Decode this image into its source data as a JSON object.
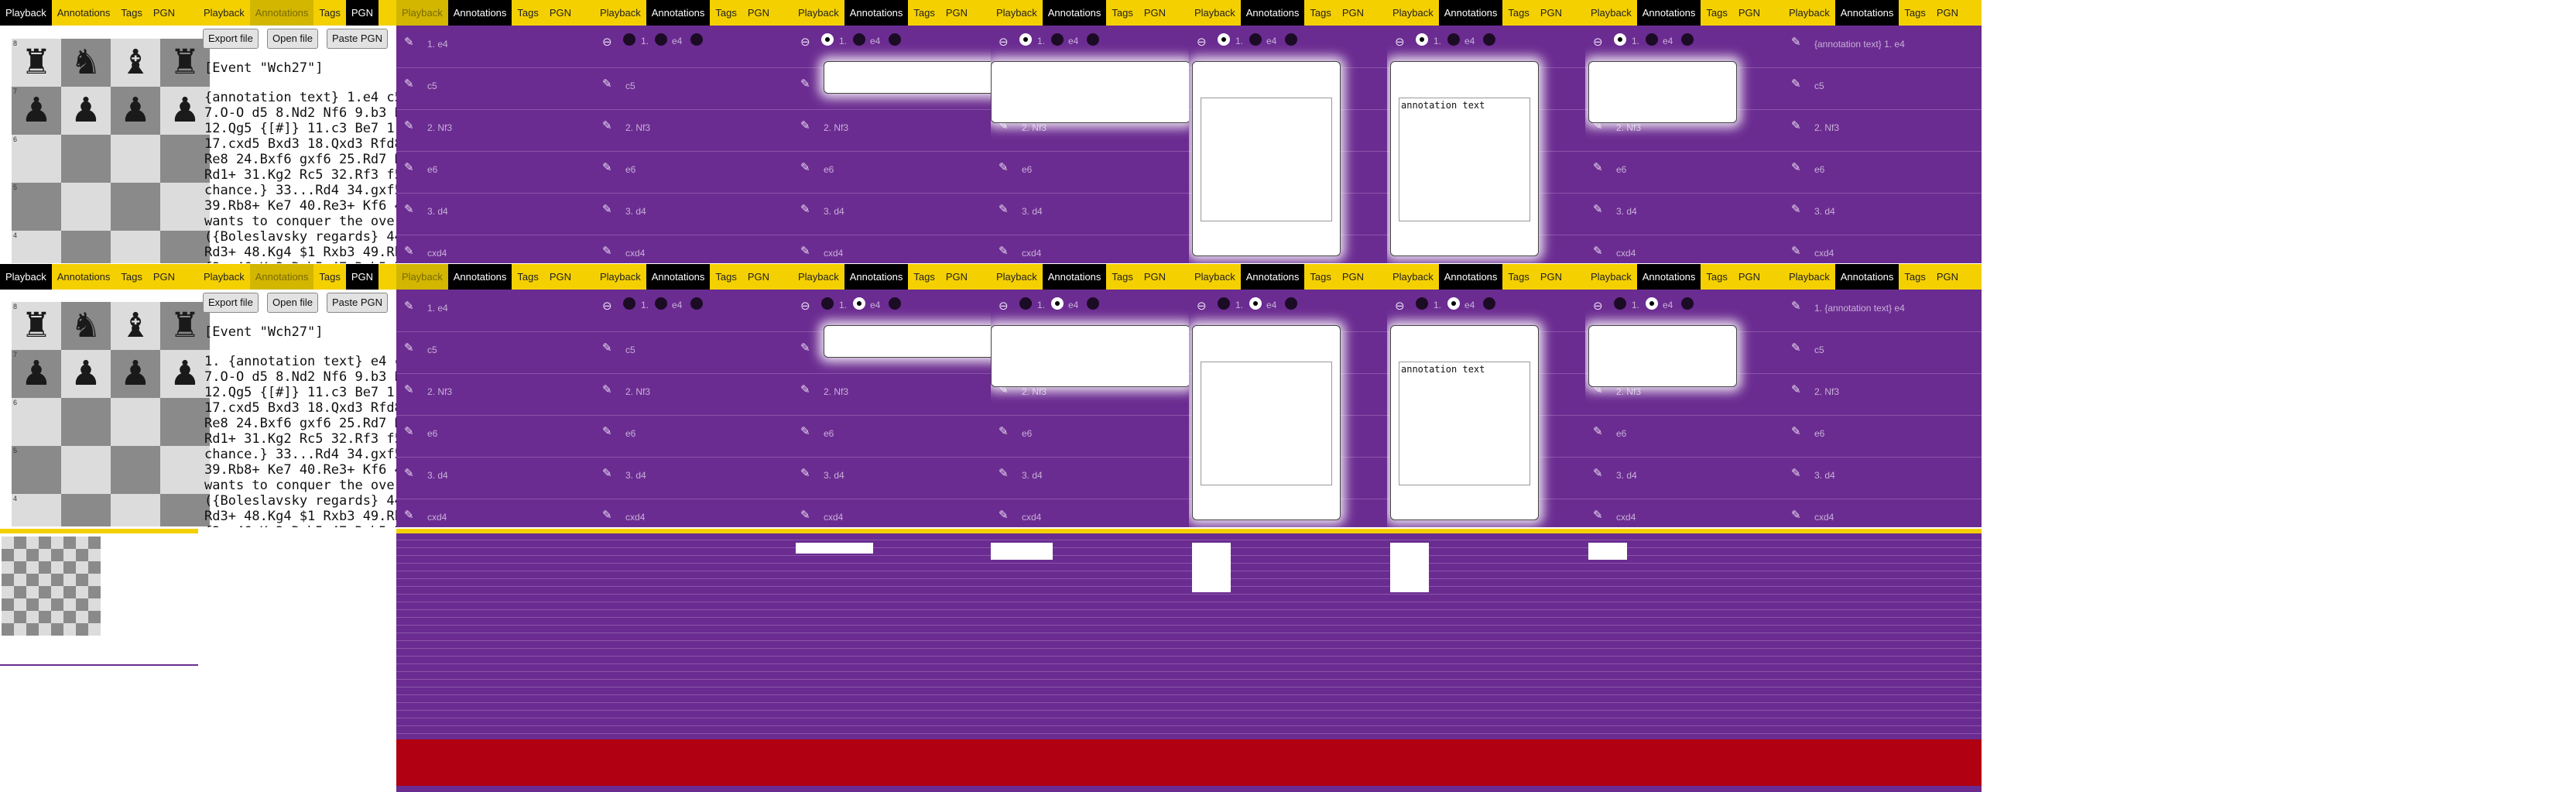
{
  "tabs": {
    "playback": "Playback",
    "annotations": "Annotations",
    "tags": "Tags",
    "pgn": "PGN"
  },
  "buttons": {
    "export": "Export file",
    "open": "Open file",
    "paste": "Paste PGN"
  },
  "pgn_event": "[Event \"Wch27\"]",
  "pgn_lines_top": [
    "{annotation text} 1.e4 c5",
    "7.O-O d5 8.Nd2 Nf6 9.b3 B",
    "12.Qg5 {[#]} 11.c3 Be7 1",
    "17.cxd5 Bxd3 18.Qxd3 Rfd8",
    "Re8 24.Bxf6 gxf6 25.Rd7 R",
    "Rd1+ 31.Kg2 Rc5 32.Rf3 f5",
    "chance.} 33...Rd4 34.gxf5",
    "39.Rb8+ Ke7 40.Re3+ Kf6 4",
    "wants to conquer the over",
    "({Boleslavsky regards} 44",
    "Rd3+ 48.Kg4 $1 Rxb3 49.Rb",
    "f3+ 46.Kg3 Rxh5 47.Rxh5 R"
  ],
  "pgn_lines_bottom": [
    "1. {annotation text} e4 c",
    "7.O-O d5 8.Nd2 Nf6 9.b3 B",
    "12.Qg5 {[#]} 11.c3 Be7 1",
    "17.cxd5 Bxd3 18.Qxd3 Rfd8",
    "Re8 24.Bxf6 gxf6 25.Rd7 R",
    "Rd1+ 31.Kg2 Rc5 32.Rf3 f5",
    "chance.} 33...Rd4 34.gxf5",
    "39.Rb8+ Ke7 40.Re3+ Kf6 4",
    "wants to conquer the over",
    "({Boleslavsky regards} 44",
    "Rd3+ 48.Kg4 $1 Rxb3 49.Rb",
    "f3+ 46.Kg3 Rxh5 47.Rxh5 R"
  ],
  "board": {
    "ranks": [
      "8",
      "7",
      "6",
      "5",
      "4"
    ],
    "row8": [
      "♜",
      "♞",
      "♝",
      "♜"
    ],
    "row7": [
      "♟",
      "♟",
      "♟",
      "♟"
    ]
  },
  "moves": [
    "1. e4",
    "c5",
    "2. Nf3",
    "e6",
    "3. d4",
    "cxd4"
  ],
  "moves_first_annot": [
    "{annotation text} 1. e4",
    "c5",
    "2. Nf3",
    "e6",
    "3. d4",
    "cxd4"
  ],
  "moves_first_bottom": [
    "1. e4",
    "c5",
    "2. Nf3",
    "e6",
    "3. d4",
    "cxd4"
  ],
  "moves_last_bottom": [
    "1. {annotation text} e4",
    "c5",
    "2. Nf3",
    "e6",
    "3. d4",
    "cxd4"
  ],
  "control_move": "1.",
  "control_e4": "e4",
  "annotation_text": "annotation text",
  "colors": {
    "yellow": "#f5d000",
    "purple": "#6b2c91",
    "black": "#000000",
    "red": "#b00012"
  }
}
